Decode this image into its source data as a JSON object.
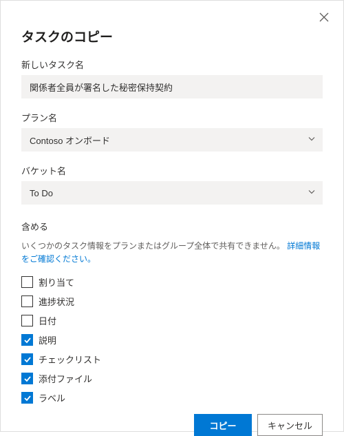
{
  "dialog": {
    "title": "タスクのコピー"
  },
  "fields": {
    "task_name": {
      "label": "新しいタスク名",
      "value": "関係者全員が署名した秘密保持契約"
    },
    "plan": {
      "label": "プラン名",
      "value": "Contoso オンボード"
    },
    "bucket": {
      "label": "バケット名",
      "value": "To Do"
    }
  },
  "include": {
    "label": "含める",
    "help_text": "いくつかのタスク情報をプランまたはグループ全体で共有できません。",
    "help_link": "詳細情報をご確認ください。",
    "options": [
      {
        "label": "割り当て",
        "checked": false
      },
      {
        "label": "進捗状況",
        "checked": false
      },
      {
        "label": "日付",
        "checked": false
      },
      {
        "label": "説明",
        "checked": true
      },
      {
        "label": "チェックリスト",
        "checked": true
      },
      {
        "label": "添付ファイル",
        "checked": true
      },
      {
        "label": "ラベル",
        "checked": true
      }
    ]
  },
  "footer": {
    "copy": "コピー",
    "cancel": "キャンセル"
  }
}
